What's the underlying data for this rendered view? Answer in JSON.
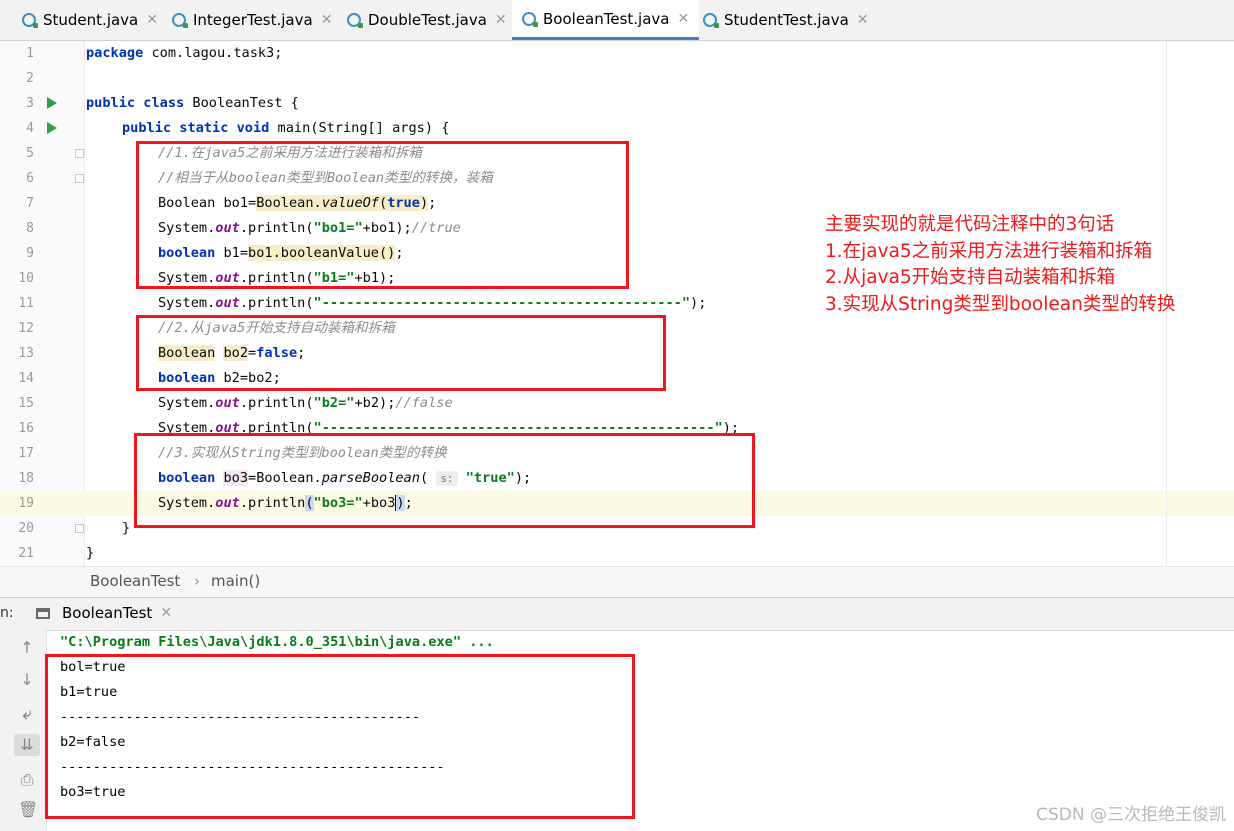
{
  "tabs": [
    {
      "label": "Student.java"
    },
    {
      "label": "IntegerTest.java"
    },
    {
      "label": "DoubleTest.java"
    },
    {
      "label": "BooleanTest.java",
      "active": true
    },
    {
      "label": "StudentTest.java"
    }
  ],
  "editor": {
    "line_numbers": [
      "1",
      "2",
      "3",
      "4",
      "5",
      "6",
      "7",
      "8",
      "9",
      "10",
      "11",
      "12",
      "13",
      "14",
      "15",
      "16",
      "17",
      "18",
      "19",
      "20",
      "21"
    ],
    "code": {
      "l1_kw": "package",
      "l1_rest": " com.lagou.task3;",
      "l3_kw1": "public",
      "l3_kw2": "class",
      "l3_rest": " BooleanTest {",
      "l4_kw1": "public",
      "l4_kw2": "static",
      "l4_kw3": "void",
      "l4_rest": " main(String[] args) {",
      "l5": "//1.在java5之前采用方法进行装箱和拆箱",
      "l6": "//相当于从boolean类型到Boolean类型的转换，装箱",
      "l7_a": "Boolean bo1=",
      "l7_b": "Boolean.",
      "l7_c": "valueOf",
      "l7_d": "(",
      "l7_e": "true",
      "l7_f": ")",
      "l7_g": ";",
      "l8_a": "System.",
      "l8_b": "out",
      "l8_c": ".println(",
      "l8_d": "\"bo1=\"",
      "l8_e": "+bo1);",
      "l8_f": "//true",
      "l9_a": "boolean",
      "l9_b": " b1=",
      "l9_c": "bo1.booleanValue()",
      "l9_d": ";",
      "l10_a": "System.",
      "l10_b": "out",
      "l10_c": ".println(",
      "l10_d": "\"b1=\"",
      "l10_e": "+b1);",
      "l11_a": "System.",
      "l11_b": "out",
      "l11_c": ".println(",
      "l11_d": "\"--------------------------------------------\"",
      "l11_e": ");",
      "l12": "//2.从java5开始支持自动装箱和拆箱",
      "l13_a": "Boolean",
      "l13_b": "bo2",
      "l13_c": "=",
      "l13_d": "false",
      "l13_e": ";",
      "l14_a": "boolean",
      "l14_b": " b2=bo2;",
      "l15_a": "System.",
      "l15_b": "out",
      "l15_c": ".println(",
      "l15_d": "\"b2=\"",
      "l15_e": "+b2);",
      "l15_f": "//false",
      "l16_a": "System.",
      "l16_b": "out",
      "l16_c": ".println(",
      "l16_d": "\"------------------------------------------------\"",
      "l16_e": ");",
      "l17": "//3.实现从String类型到boolean类型的转换",
      "l18_a": "boolean",
      "l18_b": "bo3",
      "l18_c": "=Boolean.",
      "l18_d": "parseBoolean",
      "l18_e": "(",
      "l18_hint": "s:",
      "l18_f": "\"true\"",
      "l18_g": ");",
      "l19_a": "System.",
      "l19_b": "out",
      "l19_c": ".println",
      "l19_d": "(",
      "l19_e": "\"bo3=\"",
      "l19_f": "+bo3",
      "l19_g": ")",
      "l19_h": ";",
      "l20": "}",
      "l21": "}"
    }
  },
  "annotation": {
    "lines": [
      "主要实现的就是代码注释中的3句话",
      "1.在java5之前采用方法进行装箱和拆箱",
      "2.从java5开始支持自动装箱和拆箱",
      "3.实现从String类型到boolean类型的转换"
    ],
    "color": "#f01818"
  },
  "breadcrumb": {
    "class": "BooleanTest",
    "separator": "›",
    "method": "main()"
  },
  "run_panel": {
    "label": "n:",
    "tab": "BooleanTest",
    "command": "\"C:\\Program Files\\Java\\jdk1.8.0_351\\bin\\java.exe\" ...",
    "output": [
      "bol=true",
      "b1=true",
      "--------------------------------------------",
      "b2=false",
      "-----------------------------------------------",
      "bo3=true"
    ]
  },
  "watermark": "CSDN @三次拒绝王俊凯",
  "colors": {
    "keyword": "#0033b3",
    "string": "#067d17",
    "comment": "#8c8c8c",
    "field": "#871094",
    "highlight_box": "#f0141e"
  }
}
